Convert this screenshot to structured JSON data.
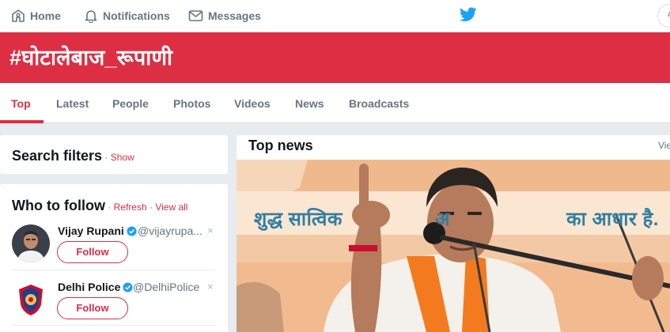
{
  "nav": {
    "home_label": "Home",
    "notifications_label": "Notifications",
    "messages_label": "Messages",
    "edge_glyph": "#"
  },
  "banner": {
    "hashtag": "#घोटालेबाज_रूपाणी"
  },
  "tabs": [
    {
      "label": "Top",
      "active": true
    },
    {
      "label": "Latest"
    },
    {
      "label": "People"
    },
    {
      "label": "Photos"
    },
    {
      "label": "Videos"
    },
    {
      "label": "News"
    },
    {
      "label": "Broadcasts"
    }
  ],
  "search_filters": {
    "title": "Search filters",
    "separator": " · ",
    "show_label": "Show"
  },
  "who_to_follow": {
    "title": "Who to follow",
    "separator": " · ",
    "refresh_label": "Refresh",
    "view_all_label": "View all",
    "accounts": [
      {
        "name": "Vijay Rupani",
        "handle": "@vijayrupa...",
        "follow_label": "Follow",
        "close": "×",
        "verified": true,
        "avatar_icon": "person-portrait"
      },
      {
        "name": "Delhi Police",
        "handle": "@DelhiPolice",
        "follow_label": "Follow",
        "close": "×",
        "verified": true,
        "avatar_icon": "police-emblem"
      }
    ]
  },
  "top_news": {
    "title": "Top news",
    "view_label": "View",
    "photo_banner_text_left": "शुद्ध सात्विक",
    "photo_banner_text_mid": "अ",
    "photo_banner_text_right": "का आधार है."
  },
  "colors": {
    "accent": "#dd2e44",
    "twitter_blue": "#1da1f2",
    "verified": "#1da1f2",
    "background": "#e6ecf0",
    "photo_banner": "#f3c9a5"
  }
}
